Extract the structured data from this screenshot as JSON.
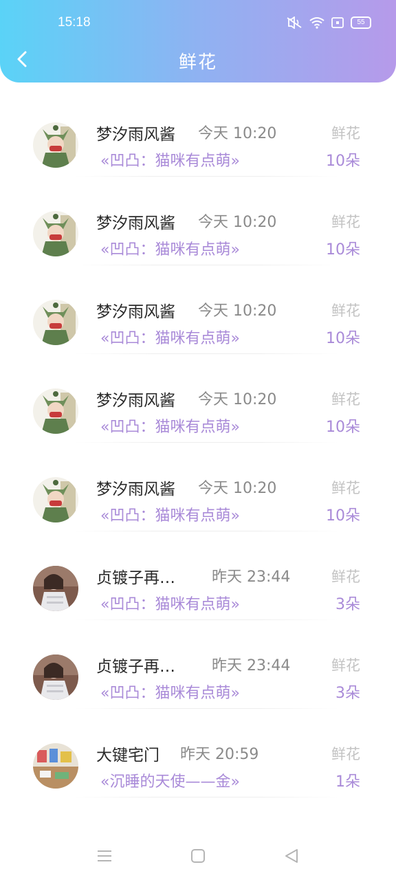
{
  "status_bar": {
    "time": "15:18",
    "battery": "55"
  },
  "header": {
    "title": "鲜花"
  },
  "rows": [
    {
      "name": "梦汐雨风酱",
      "time": "今天 10:20",
      "gift": "«凹凸：猫咪有点萌»",
      "label": "鲜花",
      "count": "10朵",
      "avatar": "cartoon"
    },
    {
      "name": "梦汐雨风酱",
      "time": "今天 10:20",
      "gift": "«凹凸：猫咪有点萌»",
      "label": "鲜花",
      "count": "10朵",
      "avatar": "cartoon"
    },
    {
      "name": "梦汐雨风酱",
      "time": "今天 10:20",
      "gift": "«凹凸：猫咪有点萌»",
      "label": "鲜花",
      "count": "10朵",
      "avatar": "cartoon"
    },
    {
      "name": "梦汐雨风酱",
      "time": "今天 10:20",
      "gift": "«凹凸：猫咪有点萌»",
      "label": "鲜花",
      "count": "10朵",
      "avatar": "cartoon"
    },
    {
      "name": "梦汐雨风酱",
      "time": "今天 10:20",
      "gift": "«凹凸：猫咪有点萌»",
      "label": "鲜花",
      "count": "10朵",
      "avatar": "cartoon"
    },
    {
      "name": "贞镀子再…",
      "time": "昨天 23:44",
      "gift": "«凹凸：猫咪有点萌»",
      "label": "鲜花",
      "count": "3朵",
      "avatar": "photo"
    },
    {
      "name": "贞镀子再…",
      "time": "昨天 23:44",
      "gift": "«凹凸：猫咪有点萌»",
      "label": "鲜花",
      "count": "3朵",
      "avatar": "photo"
    },
    {
      "name": "大键宅门",
      "time": "昨天 20:59",
      "gift": "«沉睡的天使——金»",
      "label": "鲜花",
      "count": "1朵",
      "avatar": "shop"
    }
  ]
}
